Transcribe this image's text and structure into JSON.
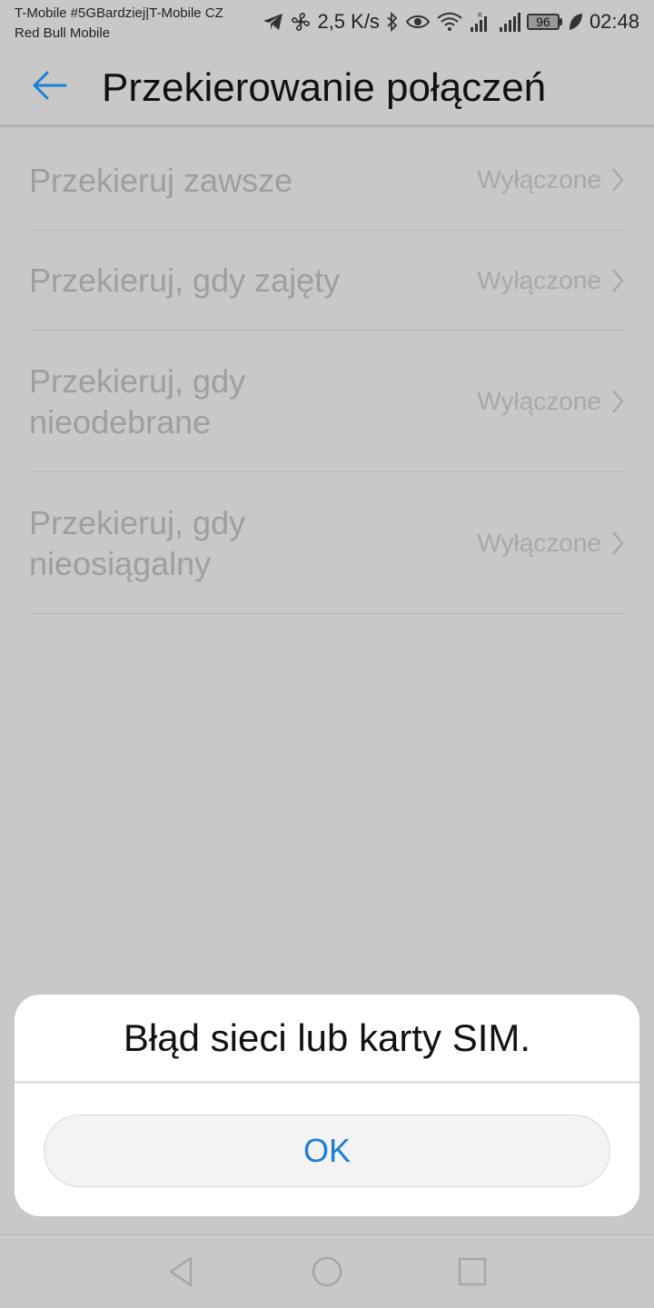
{
  "status_bar": {
    "carrier_line1": "T-Mobile #5GBardziej|T-Mobile CZ",
    "carrier_line2": "Red Bull Mobile",
    "net_speed": "2,5 K/s",
    "battery": "96",
    "time": "02:48",
    "icons": [
      "telegram-icon",
      "fan-icon",
      "bluetooth-icon",
      "eye-icon",
      "wifi-icon",
      "signal-icon",
      "signal-icon",
      "battery-icon",
      "leaf-icon"
    ]
  },
  "toolbar": {
    "back_icon": "arrow-left-icon",
    "title": "Przekierowanie połączeń"
  },
  "forwarding": {
    "items": [
      {
        "label": "Przekieruj zawsze",
        "value": "Wyłączone"
      },
      {
        "label": "Przekieruj, gdy zajęty",
        "value": "Wyłączone"
      },
      {
        "label": "Przekieruj, gdy nieodebrane",
        "value": "Wyłączone"
      },
      {
        "label": "Przekieruj, gdy nieosiągalny",
        "value": "Wyłączone"
      }
    ]
  },
  "dialog": {
    "message": "Błąd sieci lub karty SIM.",
    "ok_label": "OK"
  },
  "nav_bar": {
    "icons": [
      "back-triangle-icon",
      "home-circle-icon",
      "recents-square-icon"
    ]
  },
  "colors": {
    "accent": "#1a7fd6",
    "overlay_background": "#c8c8c8",
    "dialog_background": "#ffffff"
  }
}
